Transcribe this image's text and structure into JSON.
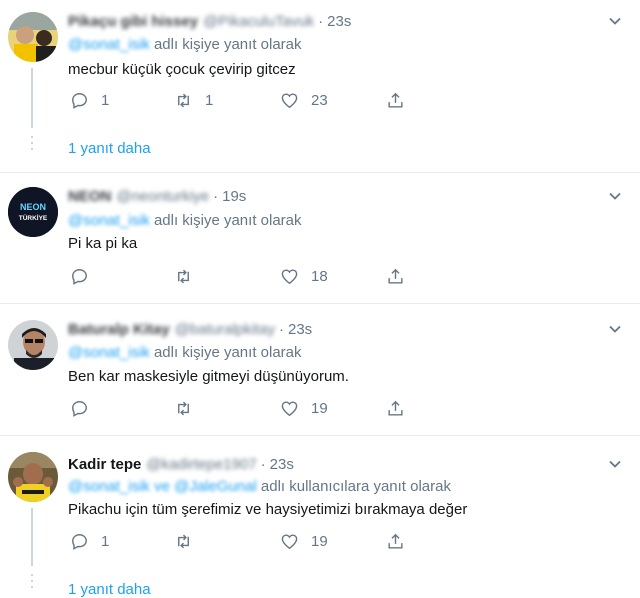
{
  "tweets": [
    {
      "name": "Pikaçu gibi hissey",
      "handle": "@PikaculuTavuk",
      "time": "23s",
      "reply_mention": "@sonat_isik",
      "reply_text": "adlı kişiye yanıt olarak",
      "text": "mecbur küçük çocuk çevirip gitcez",
      "replies": "1",
      "retweets": "1",
      "likes": "23",
      "more_replies": "1 yanıt daha"
    },
    {
      "name": "NEON",
      "handle": "@neonturkiye",
      "time": "19s",
      "reply_mention": "@sonat_isik",
      "reply_text": "adlı kişiye yanıt olarak",
      "text": "Pi ka pi ka",
      "replies": "",
      "retweets": "",
      "likes": "18",
      "avatar_text_1": "NEON",
      "avatar_text_2": "TÜRKİYE"
    },
    {
      "name": "Baturalp Kitay",
      "handle": "@baturalpkitay",
      "time": "23s",
      "reply_mention": "@sonat_isik",
      "reply_text": "adlı kişiye yanıt olarak",
      "text": "Ben kar maskesiyle gitmeyi düşünüyorum.",
      "replies": "",
      "retweets": "",
      "likes": "19"
    },
    {
      "name": "Kadir tepe",
      "handle": "@kadirtepe1907",
      "time": "23s",
      "reply_mention": "@sonat_isik ve @JaleGunal",
      "reply_text": "adlı kullanıcılara yanıt olarak",
      "text": "Pikachu için tüm şerefimiz ve haysiyetimizi bırakmaya değer",
      "replies": "1",
      "retweets": "",
      "likes": "19",
      "more_replies": "1 yanıt daha"
    }
  ],
  "colors": {
    "accent": "#1da1f2",
    "muted": "#657786",
    "separator": "#e6ecf0"
  }
}
